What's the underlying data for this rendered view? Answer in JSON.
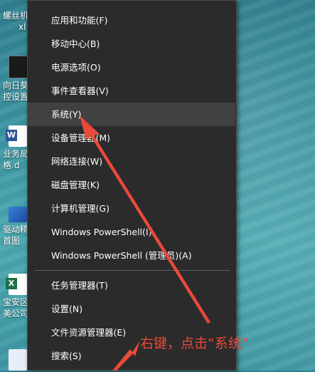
{
  "desktop_icons": [
    {
      "label": "螺丝机\nxl",
      "icon": "folder-icon"
    },
    {
      "label": "向日葵\n控设置",
      "icon": "terminal-icon"
    },
    {
      "label": "业务局\n格.d",
      "icon": "word-doc-icon"
    },
    {
      "label": "驱动精\n首图",
      "icon": "image-icon"
    },
    {
      "label": "宝安区\n美公司",
      "icon": "excel-doc-icon"
    }
  ],
  "menu": {
    "items": [
      {
        "label": "应用和功能(F)"
      },
      {
        "label": "移动中心(B)"
      },
      {
        "label": "电源选项(O)"
      },
      {
        "label": "事件查看器(V)"
      },
      {
        "label": "系统(Y)",
        "highlighted": true
      },
      {
        "label": "设备管理器(M)"
      },
      {
        "label": "网络连接(W)"
      },
      {
        "label": "磁盘管理(K)"
      },
      {
        "label": "计算机管理(G)"
      },
      {
        "label": "Windows PowerShell(I)"
      },
      {
        "label": "Windows PowerShell (管理员)(A)"
      },
      {
        "label": "任务管理器(T)"
      },
      {
        "label": "设置(N)"
      },
      {
        "label": "文件资源管理器(E)"
      },
      {
        "label": "搜索(S)"
      }
    ]
  },
  "annotation": {
    "text": "右键，点击“系统”",
    "color": "#e84a3a"
  }
}
